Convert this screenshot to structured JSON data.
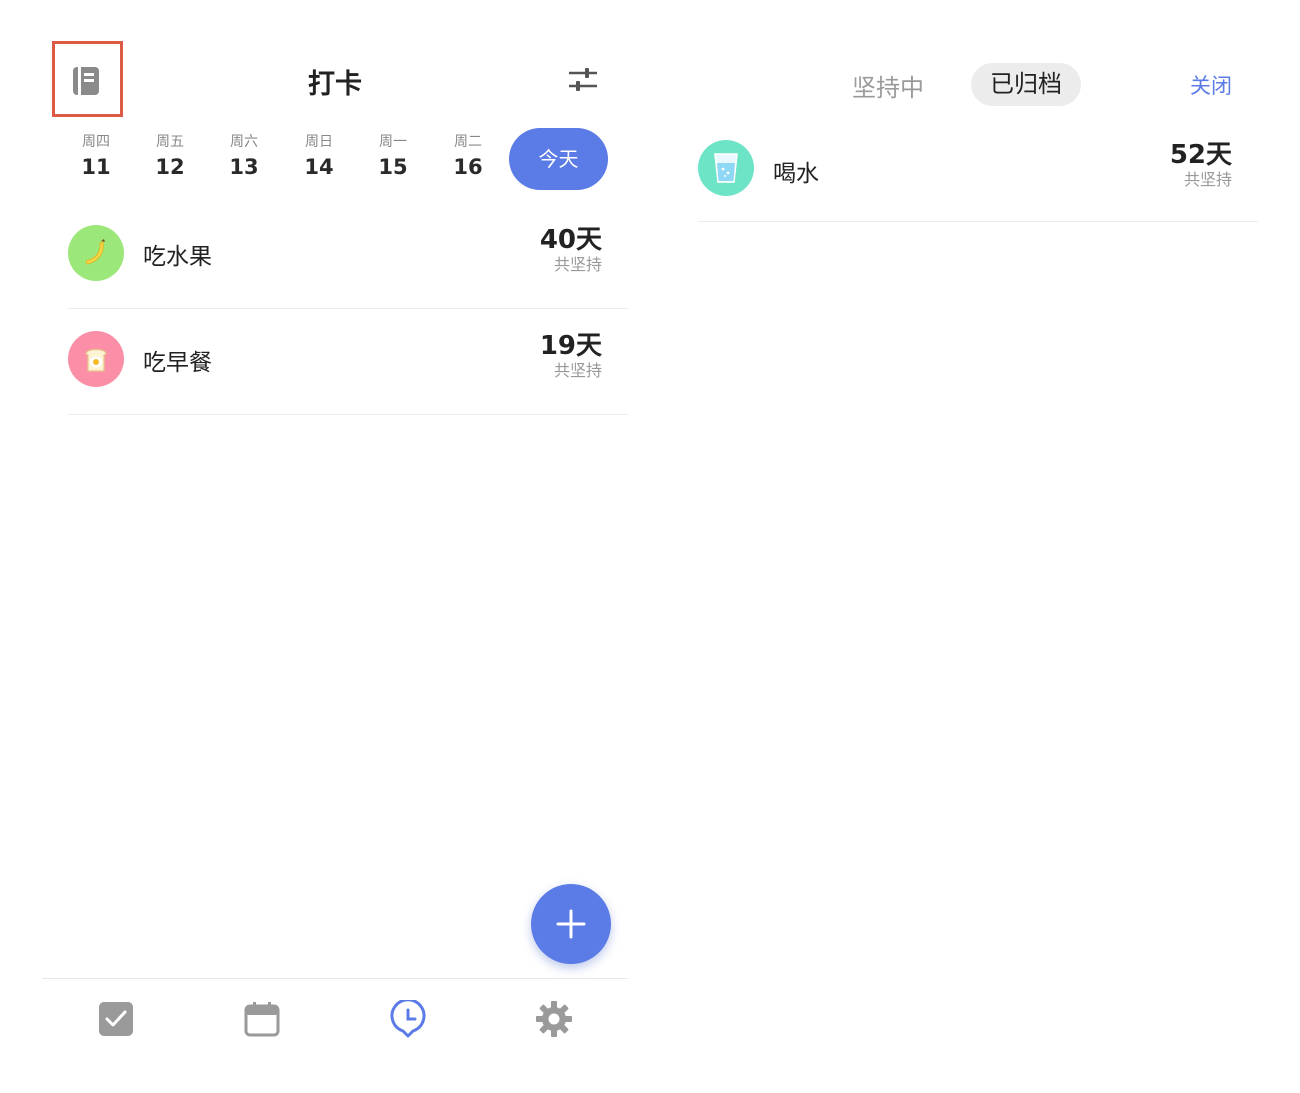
{
  "left": {
    "title": "打卡",
    "days": [
      {
        "weekday": "周四",
        "date": "11"
      },
      {
        "weekday": "周五",
        "date": "12"
      },
      {
        "weekday": "周六",
        "date": "13"
      },
      {
        "weekday": "周日",
        "date": "14"
      },
      {
        "weekday": "周一",
        "date": "15"
      },
      {
        "weekday": "周二",
        "date": "16"
      }
    ],
    "today_label": "今天",
    "habits": [
      {
        "name": "吃水果",
        "days": "40天",
        "sub": "共坚持",
        "icon": "banana-icon",
        "color": "#9be77a"
      },
      {
        "name": "吃早餐",
        "days": "19天",
        "sub": "共坚持",
        "icon": "toast-egg-icon",
        "color": "#fb8fa7"
      }
    ],
    "tabs": [
      "checklist-icon",
      "calendar-icon",
      "clock-icon",
      "gear-icon"
    ],
    "accent": "#5b7be6",
    "highlight": "#dd5a47"
  },
  "right": {
    "segments": {
      "inactive": "坚持中",
      "active": "已归档"
    },
    "close_label": "关闭",
    "habits": [
      {
        "name": "喝水",
        "days": "52天",
        "sub": "共坚持",
        "icon": "water-glass-icon",
        "color": "#6ee4c7"
      }
    ]
  }
}
